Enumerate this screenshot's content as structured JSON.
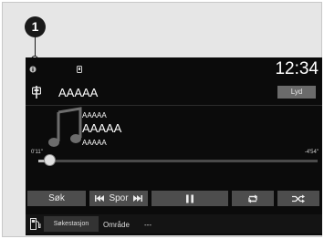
{
  "callout": {
    "number": "1"
  },
  "status": {
    "clock": "12:34",
    "left_icon": "info-dot-icon",
    "mid_icon": "phone-icon"
  },
  "source": {
    "name": "AAAAA",
    "icon": "usb-icon",
    "sound_button": "Lyd"
  },
  "track": {
    "artist": "AAAAA",
    "title": "AAAAA",
    "album": "AAAAA",
    "elapsed": "0'11\"",
    "remaining": "-4'54\"",
    "progress_fraction": 0.04
  },
  "controls": {
    "search": "Søk",
    "track": "Spor",
    "prev_icon": "skip-back-icon",
    "next_icon": "skip-forward-icon",
    "pause_icon": "pause-icon",
    "repeat_icon": "repeat-icon",
    "shuffle_icon": "shuffle-icon"
  },
  "bottom_bar": {
    "fuel_icon": "fuel-pump-icon",
    "search_station": "Søkestasjon",
    "area_label": "Område",
    "area_value": "---"
  }
}
